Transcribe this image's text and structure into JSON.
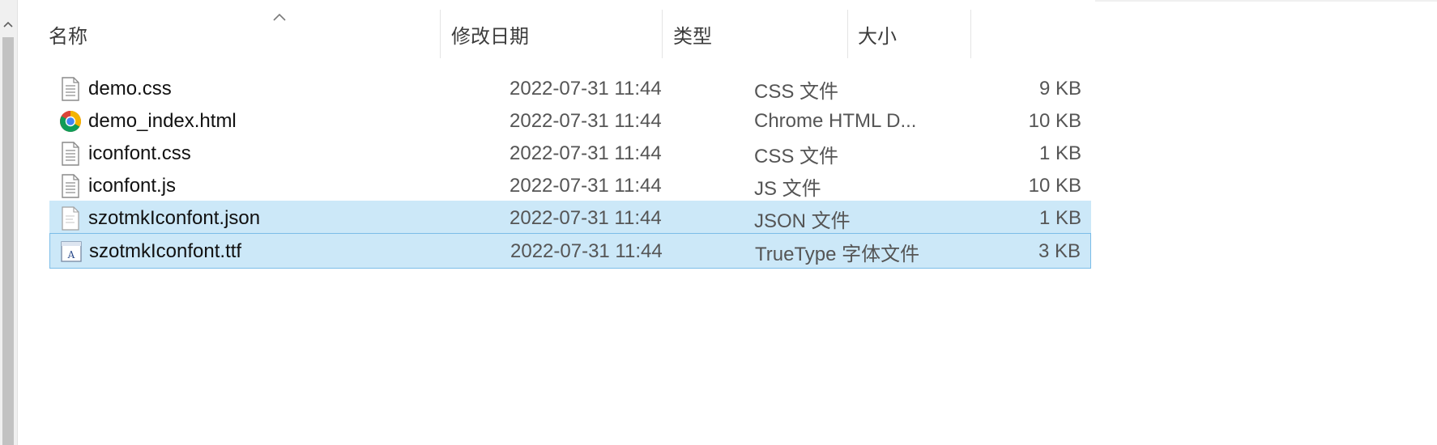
{
  "columns": {
    "name": "名称",
    "date": "修改日期",
    "type": "类型",
    "size": "大小"
  },
  "files": [
    {
      "name": "demo.css",
      "date": "2022-07-31 11:44",
      "type": "CSS 文件",
      "size": "9 KB",
      "icon": "text-file-icon"
    },
    {
      "name": "demo_index.html",
      "date": "2022-07-31 11:44",
      "type": "Chrome HTML D...",
      "size": "10 KB",
      "icon": "chrome-icon"
    },
    {
      "name": "iconfont.css",
      "date": "2022-07-31 11:44",
      "type": "CSS 文件",
      "size": "1 KB",
      "icon": "text-file-icon"
    },
    {
      "name": "iconfont.js",
      "date": "2022-07-31 11:44",
      "type": "JS 文件",
      "size": "10 KB",
      "icon": "text-file-icon"
    },
    {
      "name": "szotmkIconfont.json",
      "date": "2022-07-31 11:44",
      "type": "JSON 文件",
      "size": "1 KB",
      "icon": "json-file-icon",
      "selected": true
    },
    {
      "name": "szotmkIconfont.ttf",
      "date": "2022-07-31 11:44",
      "type": "TrueType 字体文件",
      "size": "3 KB",
      "icon": "font-file-icon",
      "selected": true,
      "focused": true
    }
  ],
  "colors": {
    "selection": "#cce8f8",
    "focus_border": "#7bbde8"
  }
}
